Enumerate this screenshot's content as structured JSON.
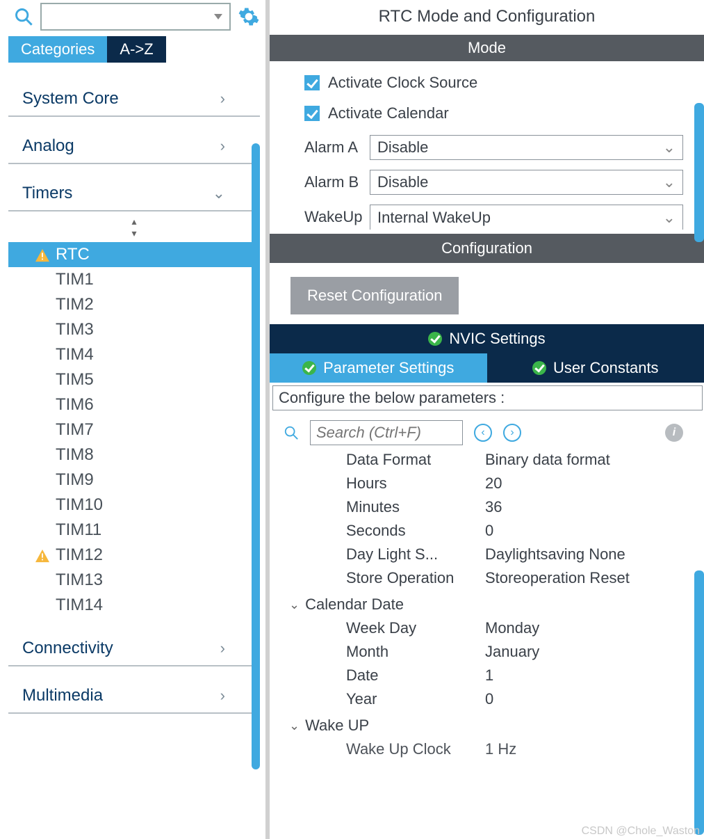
{
  "leftTabs": {
    "categories": "Categories",
    "az": "A->Z"
  },
  "sidebar": {
    "systemCore": "System Core",
    "analog": "Analog",
    "timers": "Timers",
    "connectivity": "Connectivity",
    "multimedia": "Multimedia",
    "items": [
      {
        "label": "RTC",
        "warn": true,
        "selected": true
      },
      {
        "label": "TIM1"
      },
      {
        "label": "TIM2"
      },
      {
        "label": "TIM3"
      },
      {
        "label": "TIM4"
      },
      {
        "label": "TIM5"
      },
      {
        "label": "TIM6"
      },
      {
        "label": "TIM7"
      },
      {
        "label": "TIM8"
      },
      {
        "label": "TIM9"
      },
      {
        "label": "TIM10"
      },
      {
        "label": "TIM11"
      },
      {
        "label": "TIM12",
        "warn": true
      },
      {
        "label": "TIM13"
      },
      {
        "label": "TIM14"
      }
    ]
  },
  "header": {
    "title": "RTC Mode and Configuration"
  },
  "mode": {
    "title": "Mode",
    "activateClock": "Activate Clock Source",
    "activateCalendar": "Activate Calendar",
    "alarmA": {
      "label": "Alarm A",
      "value": "Disable"
    },
    "alarmB": {
      "label": "Alarm B",
      "value": "Disable"
    },
    "wakeup": {
      "label": "WakeUp",
      "value": "Internal WakeUp"
    }
  },
  "config": {
    "title": "Configuration",
    "reset": "Reset Configuration",
    "nvic": "NVIC Settings",
    "paramTab": "Parameter Settings",
    "userTab": "User Constants",
    "instruction": "Configure the below parameters :",
    "searchPlaceholder": "Search (Ctrl+F)"
  },
  "params": {
    "dataFormat": {
      "k": "Data Format",
      "v": "Binary data format"
    },
    "hours": {
      "k": "Hours",
      "v": "20"
    },
    "minutes": {
      "k": "Minutes",
      "v": "36"
    },
    "seconds": {
      "k": "Seconds",
      "v": "0"
    },
    "daylight": {
      "k": "Day Light S...",
      "v": "Daylightsaving None"
    },
    "storeOp": {
      "k": "Store Operation",
      "v": "Storeoperation Reset"
    },
    "calGroup": "Calendar Date",
    "weekday": {
      "k": "Week Day",
      "v": "Monday"
    },
    "month": {
      "k": "Month",
      "v": "January"
    },
    "date": {
      "k": "Date",
      "v": "1"
    },
    "year": {
      "k": "Year",
      "v": "0"
    },
    "wakeGroup": "Wake UP",
    "wakeclock": {
      "k": "Wake Up Clock",
      "v": "1 Hz"
    }
  },
  "watermark": "CSDN @Chole_Waston"
}
